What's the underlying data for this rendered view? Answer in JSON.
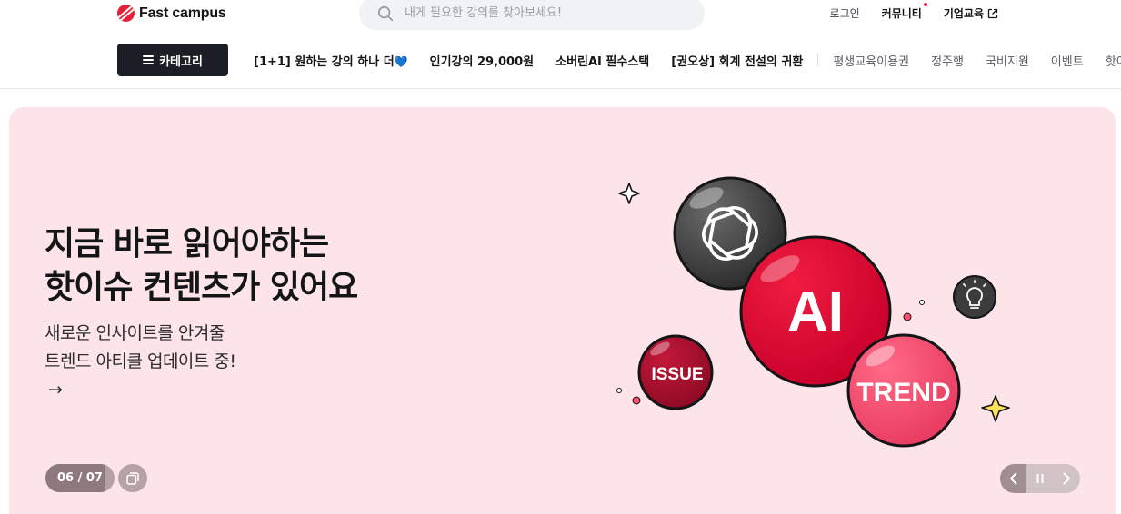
{
  "brand": {
    "name": "Fast campus",
    "color": "#e5213a"
  },
  "search": {
    "placeholder": "내게 필요한 강의를 찾아보세요!",
    "icon": "search-icon"
  },
  "utils": {
    "login": "로그인",
    "community": "커뮤니티",
    "business": "기업교육"
  },
  "nav": {
    "category_label": "카테고리",
    "items_strong": [
      "[1+1] 원하는 강의 하나 더",
      "인기강의 29,000원",
      "소버린AI 필수스택",
      "[권오상] 회계 전설의 귀환"
    ],
    "items_light": [
      "평생교육이용권",
      "정주행",
      "국비지원",
      "이벤트",
      "핫이슈"
    ]
  },
  "banner": {
    "title_line1": "지금 바로 읽어야하는",
    "title_line2": "핫이슈 컨텐츠가 있어요",
    "sub_line1": "새로운 인사이트를 안겨줄",
    "sub_line2": "트렌드 아티클 업데이트 중!",
    "arrow": "→",
    "bubbles": {
      "ai": "AI",
      "issue": "ISSUE",
      "trend": "TREND"
    },
    "background": "#fde4e8",
    "counter": "06 / 07",
    "progress": 0.857
  },
  "colors": {
    "accent_red": "#e0002a",
    "dark_red": "#b0082a",
    "pink": "#f0506e",
    "new_dot": "#ed234b"
  }
}
